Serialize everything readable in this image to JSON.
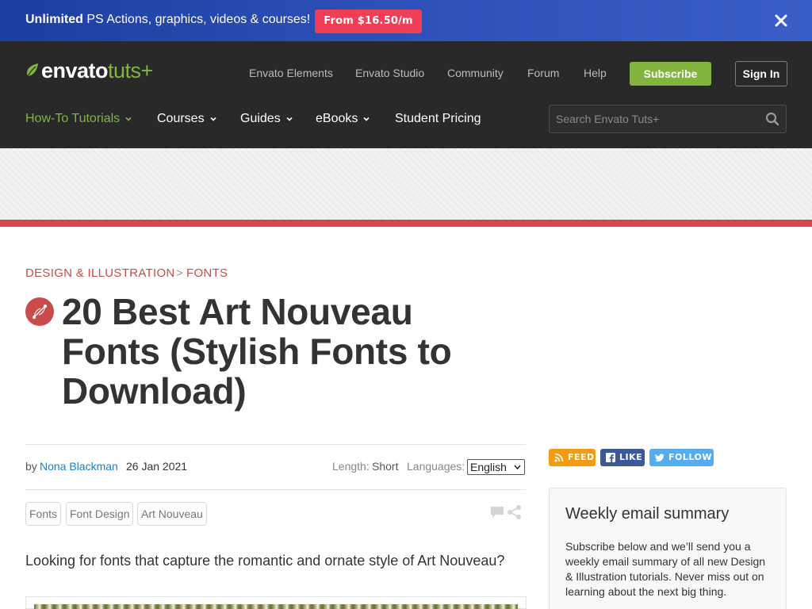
{
  "promo": {
    "text_bold": "Unlimited",
    "text_rest": " PS Actions, graphics, videos & courses!",
    "cta": "From $16.50/m"
  },
  "header": {
    "logo_main": "envato",
    "logo_accent": "tuts+",
    "top_links": [
      "Envato Elements",
      "Envato Studio",
      "Community",
      "Forum",
      "Help"
    ],
    "subscribe": "Subscribe",
    "sign_in": "Sign In",
    "main_nav": [
      {
        "label": "How-To Tutorials",
        "dropdown": true,
        "active": true
      },
      {
        "label": "Courses",
        "dropdown": true
      },
      {
        "label": "Guides",
        "dropdown": true
      },
      {
        "label": "eBooks",
        "dropdown": true
      },
      {
        "label": "Student Pricing",
        "dropdown": false
      }
    ],
    "search_placeholder": "Search Envato Tuts+"
  },
  "article": {
    "breadcrumb": [
      "DESIGN & ILLUSTRATION",
      "FONTS"
    ],
    "breadcrumb_sep": ">",
    "title_lines": [
      "20 Best Art Nouveau",
      "Fonts (Stylish Fonts to",
      "Download)"
    ],
    "byline_prefix": "by",
    "author": "Nona Blackman",
    "date": "26 Jan 2021",
    "length_label": "Length:",
    "length_value": "Short",
    "languages_label": "Languages:",
    "language_selected": "English",
    "tags": [
      "Fonts",
      "Font Design",
      "Art Nouveau"
    ],
    "lead": "Looking for fonts that capture the romantic and ornate style of Art Nouveau?"
  },
  "sidebar": {
    "feed": "FEED",
    "like": "LIKE",
    "follow": "FOLLOW",
    "email_title": "Weekly email summary",
    "email_text": "Subscribe below and we’ll send you a weekly email summary of all new Design & Illustration tutorials. Never miss out on learning about the next big thing."
  },
  "colors": {
    "brand_green": "#82b440",
    "header_bg": "#292929",
    "promo_blue": "#2d4fb8",
    "promo_cta": "#f13d55",
    "category_red": "#c94b4b",
    "link_blue": "#1f7fc2",
    "feed_orange": "#f39c12",
    "facebook_blue": "#3b5998",
    "twitter_blue": "#55acee"
  }
}
